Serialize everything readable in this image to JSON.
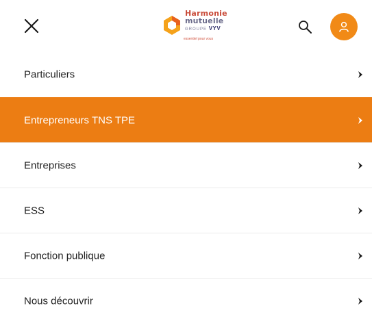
{
  "header": {
    "logo": {
      "line1": "Harmonie",
      "line2": "mutuelle",
      "groupe": "GROUPE",
      "groupe_brand": "VYV",
      "tagline": "essentiel pour vous"
    },
    "icons": {
      "close": "close-icon",
      "search": "search-icon",
      "user": "user-icon"
    },
    "accent_color": "#f18a17"
  },
  "menu": {
    "active_index": 1,
    "active_color": "#ec7d13",
    "items": [
      {
        "label": "Particuliers"
      },
      {
        "label": "Entrepreneurs TNS TPE"
      },
      {
        "label": "Entreprises"
      },
      {
        "label": "ESS"
      },
      {
        "label": "Fonction publique"
      },
      {
        "label": "Nous découvrir"
      }
    ]
  }
}
